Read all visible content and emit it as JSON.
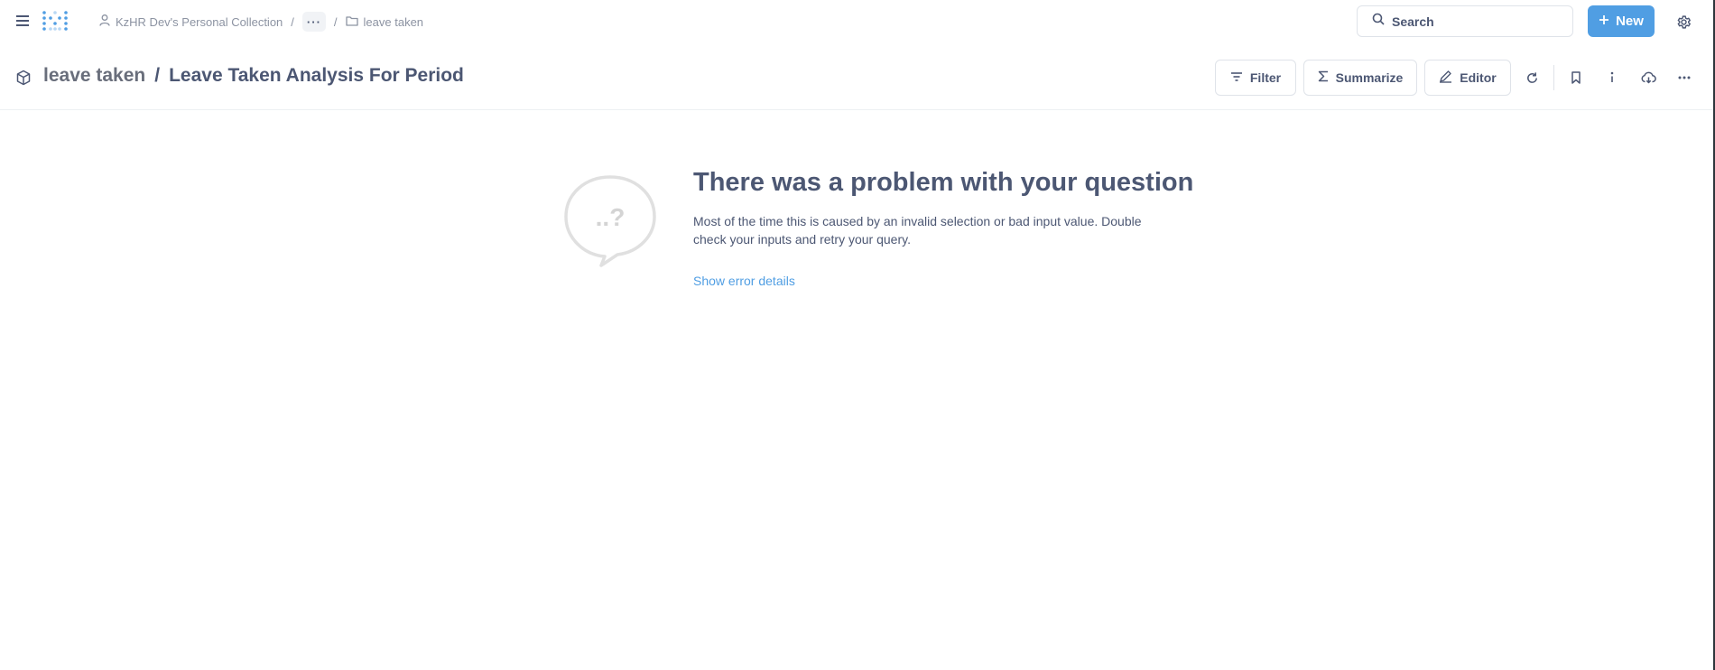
{
  "nav": {
    "breadcrumbs": {
      "collection": "KzHR Dev's Personal Collection",
      "more": "···",
      "folder": "leave taken",
      "separator": "/"
    },
    "search": {
      "label": "Search"
    },
    "new_button": "New"
  },
  "question": {
    "parent": "leave taken",
    "separator": "/",
    "title": "Leave Taken Analysis For Period",
    "actions": {
      "filter": "Filter",
      "summarize": "Summarize",
      "editor": "Editor"
    }
  },
  "error": {
    "bubble_text": "..?",
    "title": "There was a problem with your question",
    "message": "Most of the time this is caused by an invalid selection or bad input value. Double check your inputs and retry your query.",
    "details_link": "Show error details"
  },
  "colors": {
    "brand": "#509ee3",
    "text_dark": "#4c5773",
    "text_light": "#8c93a2",
    "border": "#dfe3e9"
  }
}
